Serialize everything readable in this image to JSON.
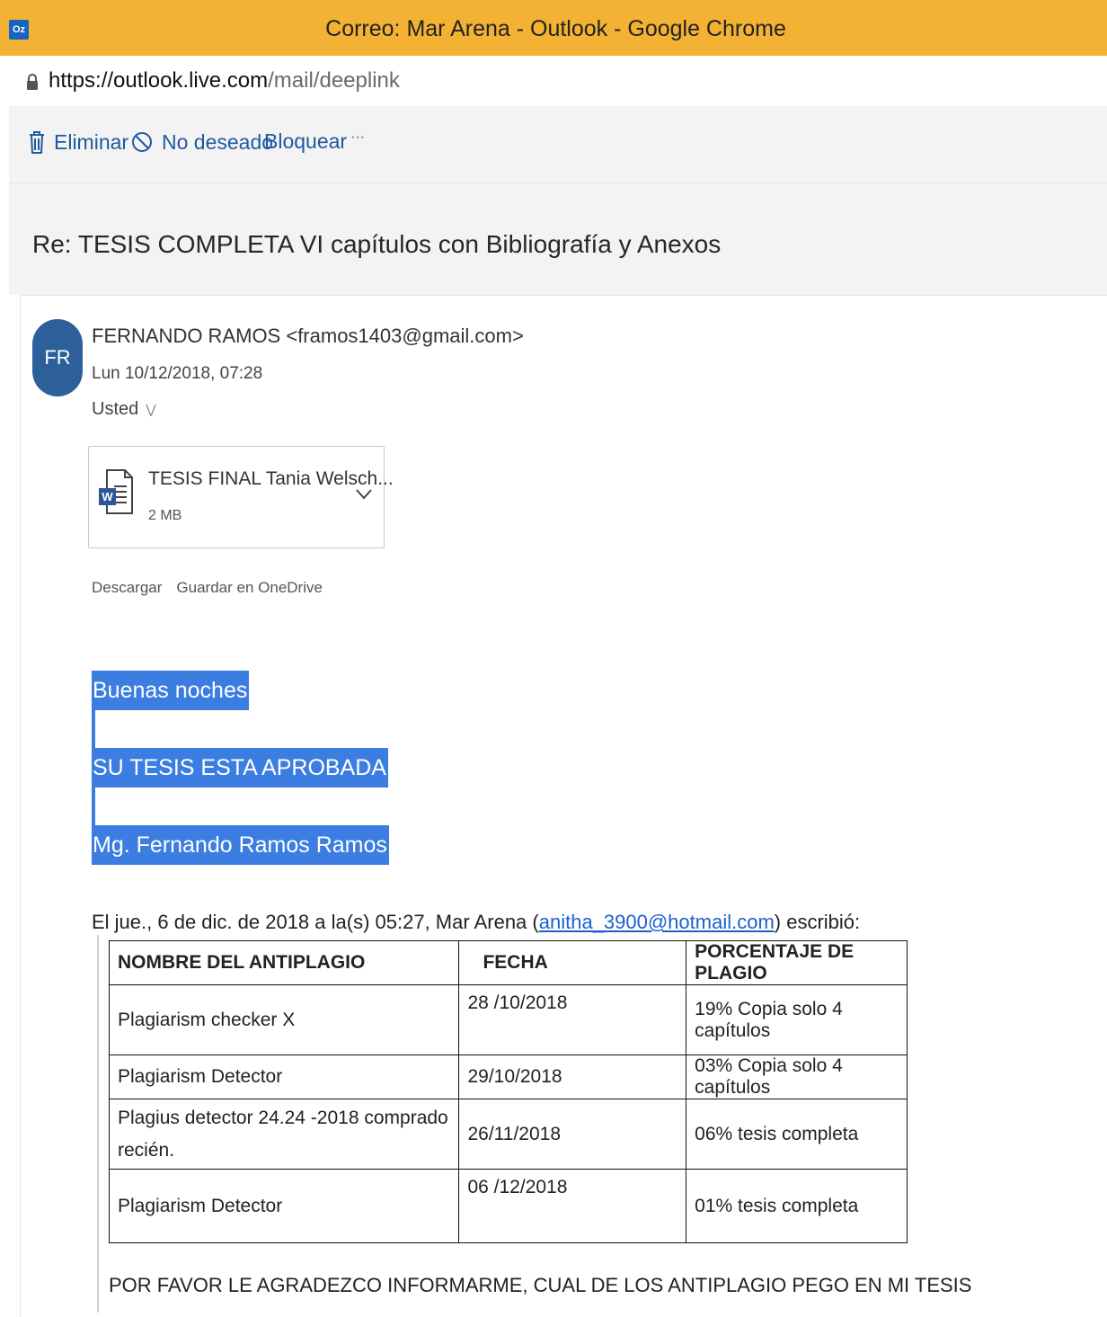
{
  "window": {
    "title": "Correo: Mar Arena - Outlook - Google Chrome",
    "app_icon_text": "Oz"
  },
  "address_bar": {
    "url_domain": "https://outlook.live.com",
    "url_path": "/mail/deeplink"
  },
  "toolbar": {
    "delete_label": "Eliminar",
    "junk_label": "No deseado",
    "block_label": "Bloquear",
    "more_label": "···"
  },
  "message": {
    "subject": "Re: TESIS COMPLETA VI capítulos con Bibliografía y Anexos",
    "avatar_initials": "FR",
    "sender": "FERNANDO RAMOS <framos1403@gmail.com>",
    "date": "Lun 10/12/2018, 07:28",
    "recipient": "Usted",
    "attachment": {
      "name": "TESIS FINAL Tania Welsch...",
      "size": "2 MB",
      "download_label": "Descargar",
      "save_onedrive_label": "Guardar en OneDrive"
    },
    "body": {
      "line1": "Buenas noches",
      "line2": "SU TESIS ESTA APROBADA",
      "line3": "Mg. Fernando Ramos Ramos"
    },
    "quote": {
      "intro_before": "El jue., 6 de dic. de 2018 a la(s) 05:27, Mar Arena (",
      "intro_email": "anitha_3900@hotmail.com",
      "intro_after": ") escribió:",
      "table": {
        "headers": [
          "NOMBRE DEL ANTIPLAGIO",
          "FECHA",
          "PORCENTAJE DE PLAGIO"
        ],
        "rows": [
          [
            "Plagiarism checker X",
            "28 /10/2018",
            "19% Copia solo 4 capítulos"
          ],
          [
            "Plagiarism Detector",
            "29/10/2018",
            "03% Copia solo 4 capítulos"
          ],
          [
            "Plagius detector 24.24 -2018 comprado recién.",
            "26/11/2018",
            "06% tesis completa"
          ],
          [
            "Plagiarism Detector",
            "06 /12/2018",
            "01% tesis completa"
          ]
        ]
      },
      "closing": "POR FAVOR LE AGRADEZCO INFORMARME, CUAL DE LOS  ANTIPLAGIO PEGO EN MI TESIS"
    }
  },
  "colors": {
    "titlebar": "#f3b233",
    "highlight": "#3b7de0",
    "link": "#1f5aa0",
    "avatar": "#2d5f9a"
  }
}
